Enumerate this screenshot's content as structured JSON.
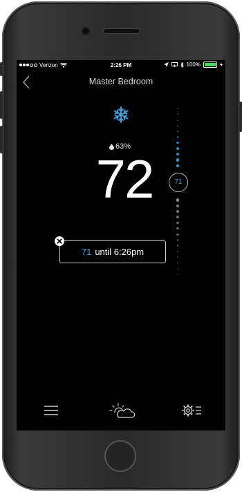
{
  "status_bar": {
    "carrier": "Verizon",
    "time": "2:26 PM",
    "battery": "100%"
  },
  "header": {
    "title": "Master Bedroom"
  },
  "thermostat": {
    "mode_icon": "snowflake-icon",
    "humidity": "63%",
    "current_temp": "72",
    "setpoint": "71",
    "hold": {
      "setpoint": "71",
      "text": "until 6:26pm"
    }
  },
  "nav": {
    "items": [
      "menu-icon",
      "weather-icon",
      "settings-icon"
    ]
  },
  "colors": {
    "accent": "#3d9fe0",
    "background": "#000000",
    "text": "#ffffff"
  }
}
